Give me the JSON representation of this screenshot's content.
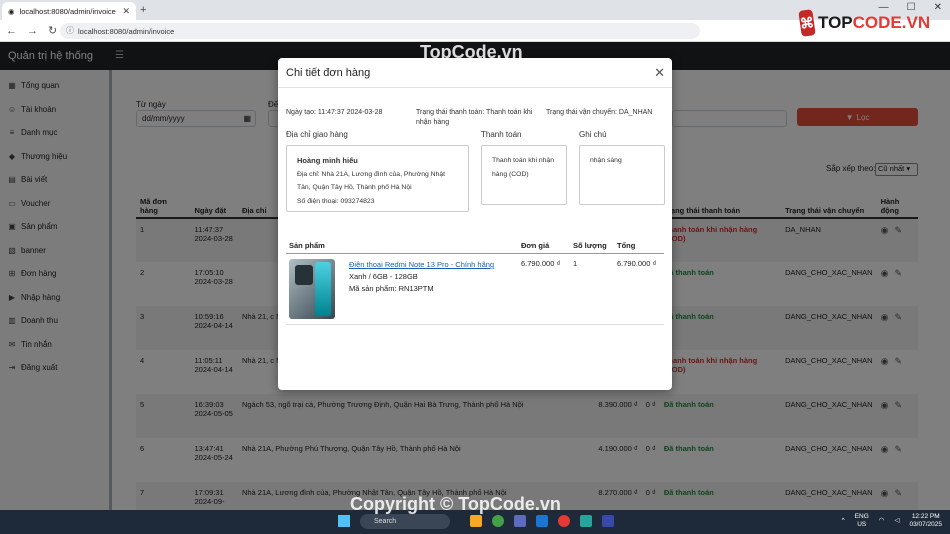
{
  "browser": {
    "tab_title": "localhost:8080/admin/invoice",
    "url": "localhost:8080/admin/invoice"
  },
  "watermark": {
    "logo_text_1": "TOP",
    "logo_text_2": "CODE.VN",
    "center_text": "TopCode.vn",
    "bottom_text": "Copyright © TopCode.vn"
  },
  "app": {
    "brand": "Quản trị hệ thống"
  },
  "sidebar": {
    "items": [
      {
        "label": "Tổng quan",
        "icon": "dashboard-icon"
      },
      {
        "label": "Tài khoản",
        "icon": "user-icon"
      },
      {
        "label": "Danh mục",
        "icon": "list-icon"
      },
      {
        "label": "Thương hiệu",
        "icon": "tag-icon"
      },
      {
        "label": "Bài viết",
        "icon": "article-icon"
      },
      {
        "label": "Voucher",
        "icon": "ticket-icon"
      },
      {
        "label": "Sản phẩm",
        "icon": "box-icon"
      },
      {
        "label": "banner",
        "icon": "image-icon"
      },
      {
        "label": "Đơn hàng",
        "icon": "cart-icon"
      },
      {
        "label": "Nhập hàng",
        "icon": "truck-icon"
      },
      {
        "label": "Doanh thu",
        "icon": "chart-icon"
      },
      {
        "label": "Tin nhắn",
        "icon": "message-icon"
      },
      {
        "label": "Đăng xuất",
        "icon": "logout-icon"
      }
    ]
  },
  "filters": {
    "from_label": "Từ ngày",
    "from_placeholder": "dd/mm/yyyy",
    "to_label_partial": "Đế",
    "filter_button": "Lọc",
    "sort_label": "Sắp xếp theo:",
    "sort_value": "Cũ nhất"
  },
  "orders_table": {
    "headers": [
      "Mã đơn hàng",
      "Ngày đặt",
      "Địa chỉ",
      "",
      "",
      "Trạng thái thanh toán",
      "Trạng thái vận chuyển",
      "Hành động"
    ],
    "rows": [
      {
        "id": "1",
        "time": "11:47:37",
        "date": "2024-03-28",
        "address": "",
        "total": "",
        "paid": "",
        "pay_status": "Thanh toán khi nhận hàng (COD)",
        "pay_class": "red",
        "ship": "DA_NHAN"
      },
      {
        "id": "2",
        "time": "17:05:10",
        "date": "2024-03-28",
        "address": "",
        "total": "",
        "paid": "",
        "pay_status": "Đã thanh toán",
        "pay_class": "green",
        "ship": "DANG_CHO_XAC_NHAN"
      },
      {
        "id": "3",
        "time": "10:59:16",
        "date": "2024-04-14",
        "address": "Nhà 21, c Nội",
        "total": "",
        "paid": "",
        "pay_status": "Đã thanh toán",
        "pay_class": "green",
        "ship": "DANG_CHO_XAC_NHAN"
      },
      {
        "id": "4",
        "time": "11:05:11",
        "date": "2024-04-14",
        "address": "Nhà 21, c Nội",
        "total": "",
        "paid": "",
        "pay_status": "Thanh toán khi nhận hàng (COD)",
        "pay_class": "red",
        "ship": "DANG_CHO_XAC_NHAN"
      },
      {
        "id": "5",
        "time": "16:39:03",
        "date": "2024-05-05",
        "address": "Ngách 53, ngõ trại cá, Phường Trương Định, Quận Hai Bà Trưng, Thành phố Hà Nội",
        "total": "8.390.000 ₫",
        "paid": "0 ₫",
        "pay_status": "Đã thanh toán",
        "pay_class": "green",
        "ship": "DANG_CHO_XAC_NHAN"
      },
      {
        "id": "6",
        "time": "13:47:41",
        "date": "2024-05-24",
        "address": "Nhà 21A, Phường Phú Thượng, Quận Tây Hồ, Thành phố Hà Nội",
        "total": "4.190.000 ₫",
        "paid": "0 ₫",
        "pay_status": "Đã thanh toán",
        "pay_class": "green",
        "ship": "DANG_CHO_XAC_NHAN"
      },
      {
        "id": "7",
        "time": "17:09:31",
        "date": "2024-09-",
        "address": "Nhà 21A, Lương đình của, Phường Nhật Tân, Quận Tây Hồ, Thành phố Hà Nội",
        "total": "8.270.000 ₫",
        "paid": "0 ₫",
        "pay_status": "Đã thanh toán",
        "pay_class": "green",
        "ship": "DANG_CHO_XAC_NHAN"
      }
    ]
  },
  "modal": {
    "title": "Chi tiết đơn hàng",
    "created": "Ngày tạo: 11:47:37 2024-03-28",
    "pay_status": "Trạng thái thanh toán: Thanh toán khi nhận hàng",
    "ship_status": "Trạng thái vận chuyển: DA_NHAN",
    "address_label": "Địa chỉ giao hàng",
    "payment_label": "Thanh toán",
    "note_label": "Ghi chú",
    "customer_name": "Hoàng minh hiếu",
    "address_line": "Địa chỉ: Nhà 21A, Lương đình của, Phường Nhật Tân, Quận Tây Hồ, Thành phố Hà Nội",
    "phone_line": "Số điện thoại: 093274823",
    "payment_method": "Thanh toán khi nhận hàng (COD)",
    "note": "nhận sáng",
    "product_headers": {
      "product": "Sản phẩm",
      "price": "Đơn giá",
      "qty": "Số lượng",
      "total": "Tổng"
    },
    "product": {
      "name": "Điện thoại Redmi Note 13 Pro - Chính hãng",
      "variant": "Xanh / 6GB - 128GB",
      "sku": "Mã sản phẩm: RN13PTM",
      "price": "6.790.000 ₫",
      "qty": "1",
      "total": "6.790.000 ₫"
    }
  },
  "taskbar": {
    "search": "Search",
    "lang": "ENG",
    "region": "US",
    "time": "12:22 PM",
    "date": "03/07/2025"
  }
}
